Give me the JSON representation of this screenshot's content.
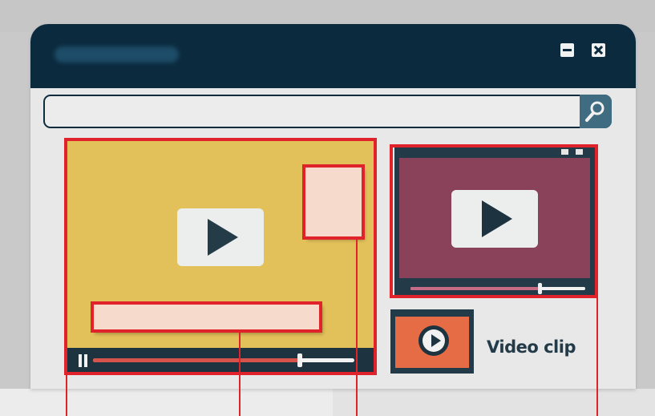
{
  "window": {
    "title": "",
    "controls": [
      "minimize-icon",
      "close-icon"
    ]
  },
  "search": {
    "value": "",
    "icon": "search-icon"
  },
  "main_video": {
    "background": "#e3c15a",
    "icon": "play-icon",
    "control_icon": "pause-icon",
    "progress": 0.79
  },
  "side_video": {
    "background": "#8a425a",
    "icon": "play-icon",
    "progress": 0.74
  },
  "thumbnail": {
    "background": "#e66c46",
    "label": "Video clip",
    "icon": "play-circle-icon"
  },
  "highlight_color": "#e0222b"
}
